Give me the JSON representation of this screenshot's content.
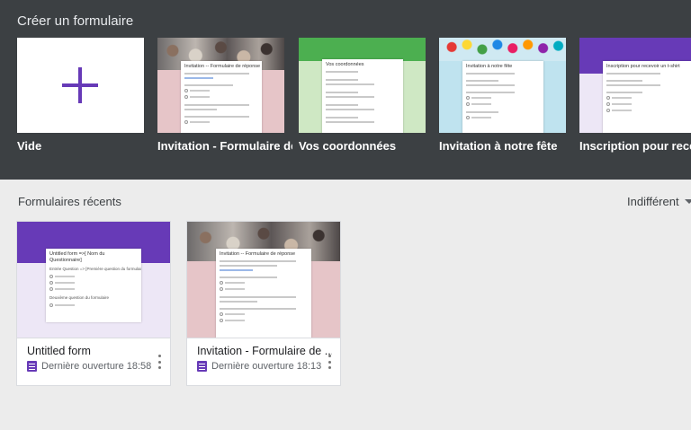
{
  "gallery": {
    "title": "Créer un formulaire",
    "templates": [
      {
        "label": "Vide",
        "thumb_title": ""
      },
      {
        "label": "Invitation - Formulaire de ...",
        "thumb_title": "Invitation -- Formulaire de réponse"
      },
      {
        "label": "Vos coordonnées",
        "thumb_title": "Vos coordonnées"
      },
      {
        "label": "Invitation à notre fête",
        "thumb_title": "Invitation à notre fête"
      },
      {
        "label": "Inscription pour recevoir",
        "thumb_title": "Inscription pour recevoir un t-shirt"
      }
    ]
  },
  "recent": {
    "title": "Formulaires récents",
    "sort_label": "Indifférent",
    "forms": [
      {
        "title": "Untitled form",
        "opened": "Dernière ouverture  18:58",
        "thumb_title": "Untitled form =>[ Nom du Questionnaire]",
        "thumb_q1": "Entrée Question => [Première question du formulaire]",
        "thumb_q2": "Deuxième question du formulaire"
      },
      {
        "title": "Invitation - Formulaire de ...",
        "opened": "Dernière ouverture  18:13",
        "thumb_title": "Invitation -- Formulaire de réponse"
      }
    ]
  },
  "colors": {
    "accent": "#673ab7",
    "gallery_bg": "#3c4043",
    "page_bg": "#ececec"
  }
}
